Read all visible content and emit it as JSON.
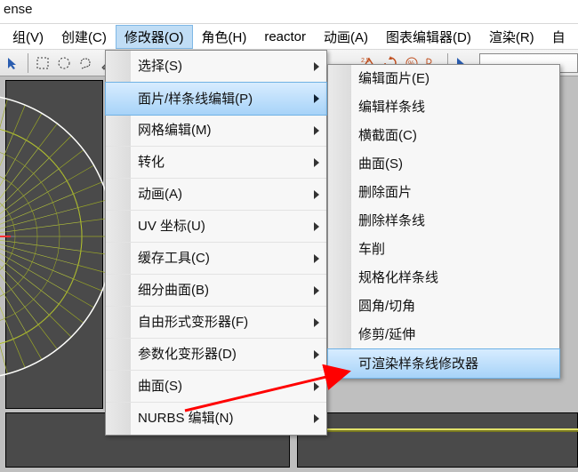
{
  "window": {
    "title_fragment": "ense"
  },
  "menubar": {
    "items": [
      {
        "label": "组(V)"
      },
      {
        "label": "创建(C)"
      },
      {
        "label": "修改器(O)",
        "open": true
      },
      {
        "label": "角色(H)"
      },
      {
        "label": "reactor"
      },
      {
        "label": "动画(A)"
      },
      {
        "label": "图表编辑器(D)"
      },
      {
        "label": "渲染(R)"
      },
      {
        "label": "自"
      }
    ]
  },
  "modifier_menu": {
    "items": [
      {
        "label": "选择(S)",
        "has_sub": true,
        "highlight": false
      },
      {
        "label": "面片/样条线编辑(P)",
        "has_sub": true,
        "highlight": true
      },
      {
        "label": "网格编辑(M)",
        "has_sub": true,
        "highlight": false
      },
      {
        "label": "转化",
        "has_sub": true,
        "highlight": false
      },
      {
        "label": "动画(A)",
        "has_sub": true,
        "highlight": false
      },
      {
        "label": "UV 坐标(U)",
        "has_sub": true,
        "highlight": false
      },
      {
        "label": "缓存工具(C)",
        "has_sub": true,
        "highlight": false
      },
      {
        "label": "细分曲面(B)",
        "has_sub": true,
        "highlight": false
      },
      {
        "label": "自由形式变形器(F)",
        "has_sub": true,
        "highlight": false
      },
      {
        "label": "参数化变形器(D)",
        "has_sub": true,
        "highlight": false
      },
      {
        "label": "曲面(S)",
        "has_sub": true,
        "highlight": false
      },
      {
        "label": "NURBS 编辑(N)",
        "has_sub": true,
        "highlight": false
      }
    ]
  },
  "submenu": {
    "items": [
      {
        "label": "编辑面片(E)",
        "highlight": false
      },
      {
        "label": "编辑样条线",
        "highlight": false
      },
      {
        "label": "横截面(C)",
        "highlight": false
      },
      {
        "label": "曲面(S)",
        "highlight": false
      },
      {
        "label": "删除面片",
        "highlight": false
      },
      {
        "label": "删除样条线",
        "highlight": false
      },
      {
        "label": "车削",
        "highlight": false
      },
      {
        "label": "规格化样条线",
        "highlight": false
      },
      {
        "label": "圆角/切角",
        "highlight": false
      },
      {
        "label": "修剪/延伸",
        "highlight": false
      },
      {
        "label": "可渲染样条线修改器",
        "highlight": true
      }
    ]
  },
  "toolbar": {
    "icons": [
      "cursor-icon",
      "dashed-select-icon",
      "circle-select-icon",
      "lasso-icon",
      "brush-icon",
      "window-cross-icon",
      "angle-snap-icon",
      "spinner-icon",
      "arc-tool-icon",
      "abc-icon",
      "pick-cursor-icon"
    ]
  },
  "colors": {
    "highlight_bg": "#c0ddf5",
    "highlight_border": "#7fb8e6",
    "viewport_bg": "#4a4a4a",
    "wire_color": "#d6e83a",
    "axis_x": "#ff3030",
    "axis_y": "#30ff30",
    "arrow_color": "#ff0000"
  }
}
